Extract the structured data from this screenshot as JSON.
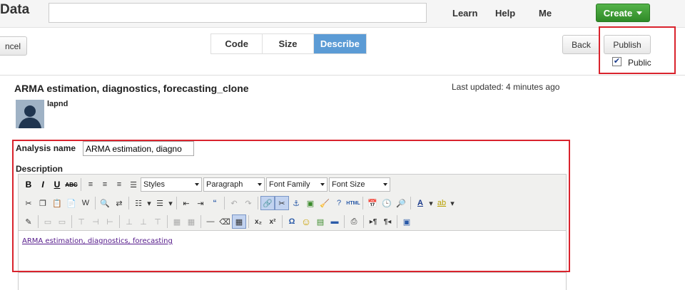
{
  "header": {
    "brand": "Data",
    "search_value": "",
    "nav": [
      "Learn",
      "Help",
      "Me"
    ],
    "create_label": "Create"
  },
  "actions": {
    "cancel_label": "ncel",
    "tabs": [
      {
        "label": "Code",
        "active": false
      },
      {
        "label": "Size",
        "active": false
      },
      {
        "label": "Describe",
        "active": true
      }
    ],
    "back_label": "Back",
    "publish_label": "Publish",
    "public_label": "Public",
    "public_checked": true
  },
  "analysis": {
    "title": "ARMA estimation, diagnostics, forecasting_clone",
    "last_updated": "Last updated: 4 minutes ago",
    "username": "lapnd",
    "name_label": "Analysis name",
    "name_value": "ARMA estimation, diagno",
    "description_label": "Description"
  },
  "editor": {
    "dropdowns": [
      "Styles",
      "Paragraph",
      "Font Family",
      "Font Size"
    ],
    "content_link": "ARMA estimation, diagnostics, forecasting"
  },
  "colors": {
    "highlight": "#d9232d",
    "create_green": "#3a9a31",
    "active_tab": "#5b9bd5",
    "link": "#551a8b"
  }
}
